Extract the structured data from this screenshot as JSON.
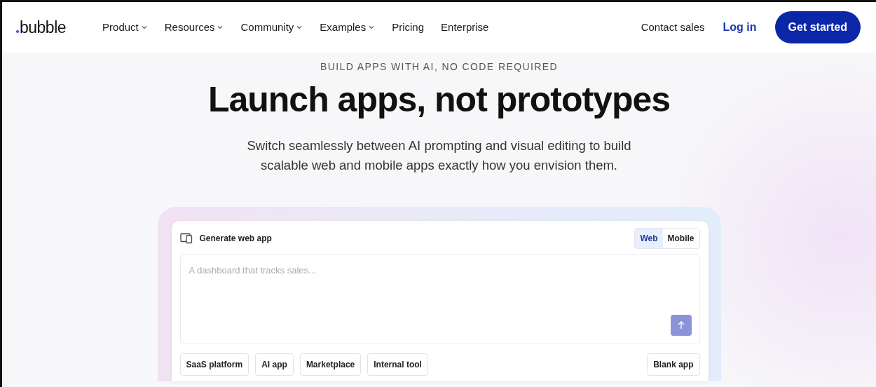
{
  "navbar": {
    "logo": "bubble",
    "menu": [
      {
        "label": "Product",
        "dropdown": true
      },
      {
        "label": "Resources",
        "dropdown": true
      },
      {
        "label": "Community",
        "dropdown": true
      },
      {
        "label": "Examples",
        "dropdown": true
      },
      {
        "label": "Pricing",
        "dropdown": false
      },
      {
        "label": "Enterprise",
        "dropdown": false
      }
    ],
    "contact": "Contact sales",
    "login": "Log in",
    "cta": "Get started"
  },
  "hero": {
    "eyebrow": "BUILD APPS WITH AI, NO CODE REQUIRED",
    "title": "Launch apps, not prototypes",
    "subtitle": "Switch seamlessly between AI prompting and visual editing to build scalable web and mobile apps exactly how you envision them."
  },
  "generator": {
    "title": "Generate web app",
    "tabs": [
      {
        "label": "Web",
        "selected": true
      },
      {
        "label": "Mobile",
        "selected": false
      }
    ],
    "prompt": {
      "placeholder": "A dashboard that tracks sales..."
    },
    "submit": {
      "disabled": true
    },
    "suggestions": [
      "SaaS platform",
      "AI app",
      "Marketplace",
      "Internal tool"
    ],
    "blank": "Blank app"
  }
}
